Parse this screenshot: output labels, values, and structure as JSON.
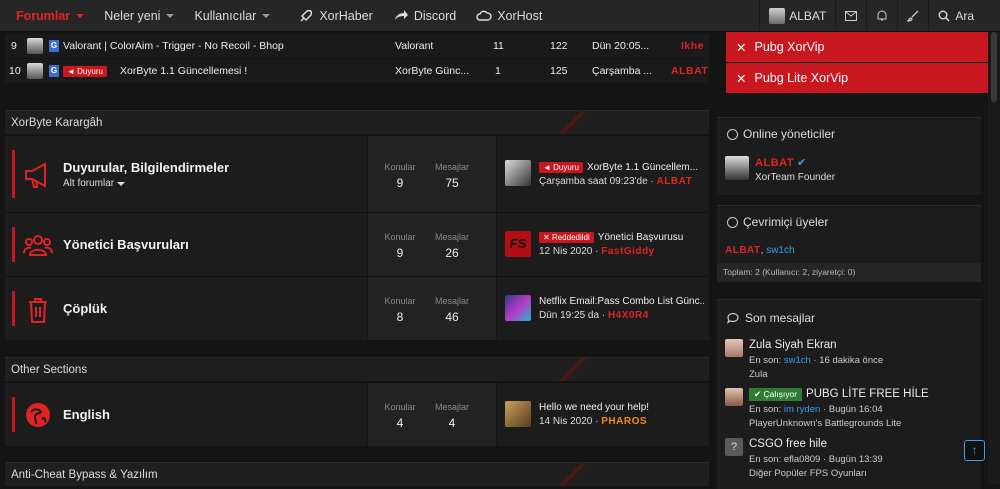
{
  "nav": {
    "items": [
      {
        "label": "Forumlar",
        "active": true,
        "dropdown": true
      },
      {
        "label": "Neler yeni",
        "dropdown": true
      },
      {
        "label": "Kullanıcılar",
        "dropdown": true
      },
      {
        "label": "XorHaber",
        "icon": "rocket-icon"
      },
      {
        "label": "Discord",
        "icon": "share-icon"
      },
      {
        "label": "XorHost",
        "icon": "cloud-icon"
      }
    ],
    "user": "ALBAT",
    "search": "Ara"
  },
  "threads": [
    {
      "num": "9",
      "prefix": "",
      "title": "Valorant | ColorAim - Trigger - No Recoil - Bhop",
      "forum": "Valorant",
      "replies": "11",
      "views": "122",
      "date": "Dün 20:05...",
      "user": "Ikhe"
    },
    {
      "num": "10",
      "prefix": "Duyuru",
      "title": "XorByte 1.1 Güncellemesi !",
      "forum": "XorByte Günc...",
      "replies": "1",
      "views": "125",
      "date": "Çarşamba ...",
      "user": "ALBAT"
    }
  ],
  "sections": [
    {
      "title": "XorByte Karargâh",
      "forums": [
        {
          "title": "Duyurular, Bilgilendirmeler",
          "sub": "Alt forumlar",
          "konular_label": "Konular",
          "konular": "9",
          "mesajlar_label": "Mesajlar",
          "mesajlar": "75",
          "last_prefix": "Duyuru",
          "last_title": "XorByte 1.1 Güncellem...",
          "last_date": "Çarşamba saat 09:23'de ·",
          "last_user": "ALBAT"
        },
        {
          "title": "Yönetici Başvuruları",
          "konular_label": "Konular",
          "konular": "9",
          "mesajlar_label": "Mesajlar",
          "mesajlar": "26",
          "last_prefix": "Reddedildi",
          "last_title": "Yönetici Başvurusu",
          "last_date": "12 Nis 2020 ·",
          "last_user": "FastGiddy"
        },
        {
          "title": "Çöplük",
          "konular_label": "Konular",
          "konular": "8",
          "mesajlar_label": "Mesajlar",
          "mesajlar": "46",
          "last_title": "Netflix Email:Pass Combo List Günc...",
          "last_date": "Dün 19:25 da ·",
          "last_user": "H4X0R4"
        }
      ]
    },
    {
      "title": "Other Sections",
      "forums": [
        {
          "title": "English",
          "konular_label": "Konular",
          "konular": "4",
          "mesajlar_label": "Mesajlar",
          "mesajlar": "4",
          "last_title": "Hello we need your help!",
          "last_date": "14 Nis 2020 ·",
          "last_user": "PHAROS"
        }
      ]
    },
    {
      "title": "Anti-Cheat Bypass & Yazılım"
    }
  ],
  "sidebar": {
    "buttons": [
      "Pubg XorVip",
      "Pubg Lite XorVip"
    ],
    "online_admins": {
      "title": "Online yöneticiler",
      "user": "ALBAT",
      "role": "XorTeam Founder"
    },
    "online_users": {
      "title": "Çevrimiçi üyeler",
      "users": [
        "ALBAT",
        "sw1ch"
      ],
      "total": "Toplam: 2 (Kullanıcı: 2, ziyaretçi: 0)"
    },
    "recent": {
      "title": "Son mesajlar",
      "items": [
        {
          "title": "Zula Siyah Ekran",
          "by_label": "En son:",
          "by": "sw1ch",
          "time": "16 dakika önce",
          "forum": "Zula"
        },
        {
          "badge": "Çalışıyor",
          "title": "PUBG LİTE FREE HİLE",
          "by_label": "En son:",
          "by": "im ryden",
          "time": "Bugün 16:04",
          "forum": "PlayerUnknown's Battlegrounds Lite"
        },
        {
          "title": "CSGO free hile",
          "by_label": "En son:",
          "by": "efla0809",
          "time": "Bugün 13:39",
          "forum": "Diğer Popüler FPS Oyunları"
        }
      ]
    }
  },
  "colors": {
    "accent": "#c8171e",
    "link": "#3aa0e8",
    "bg": "#141414"
  }
}
